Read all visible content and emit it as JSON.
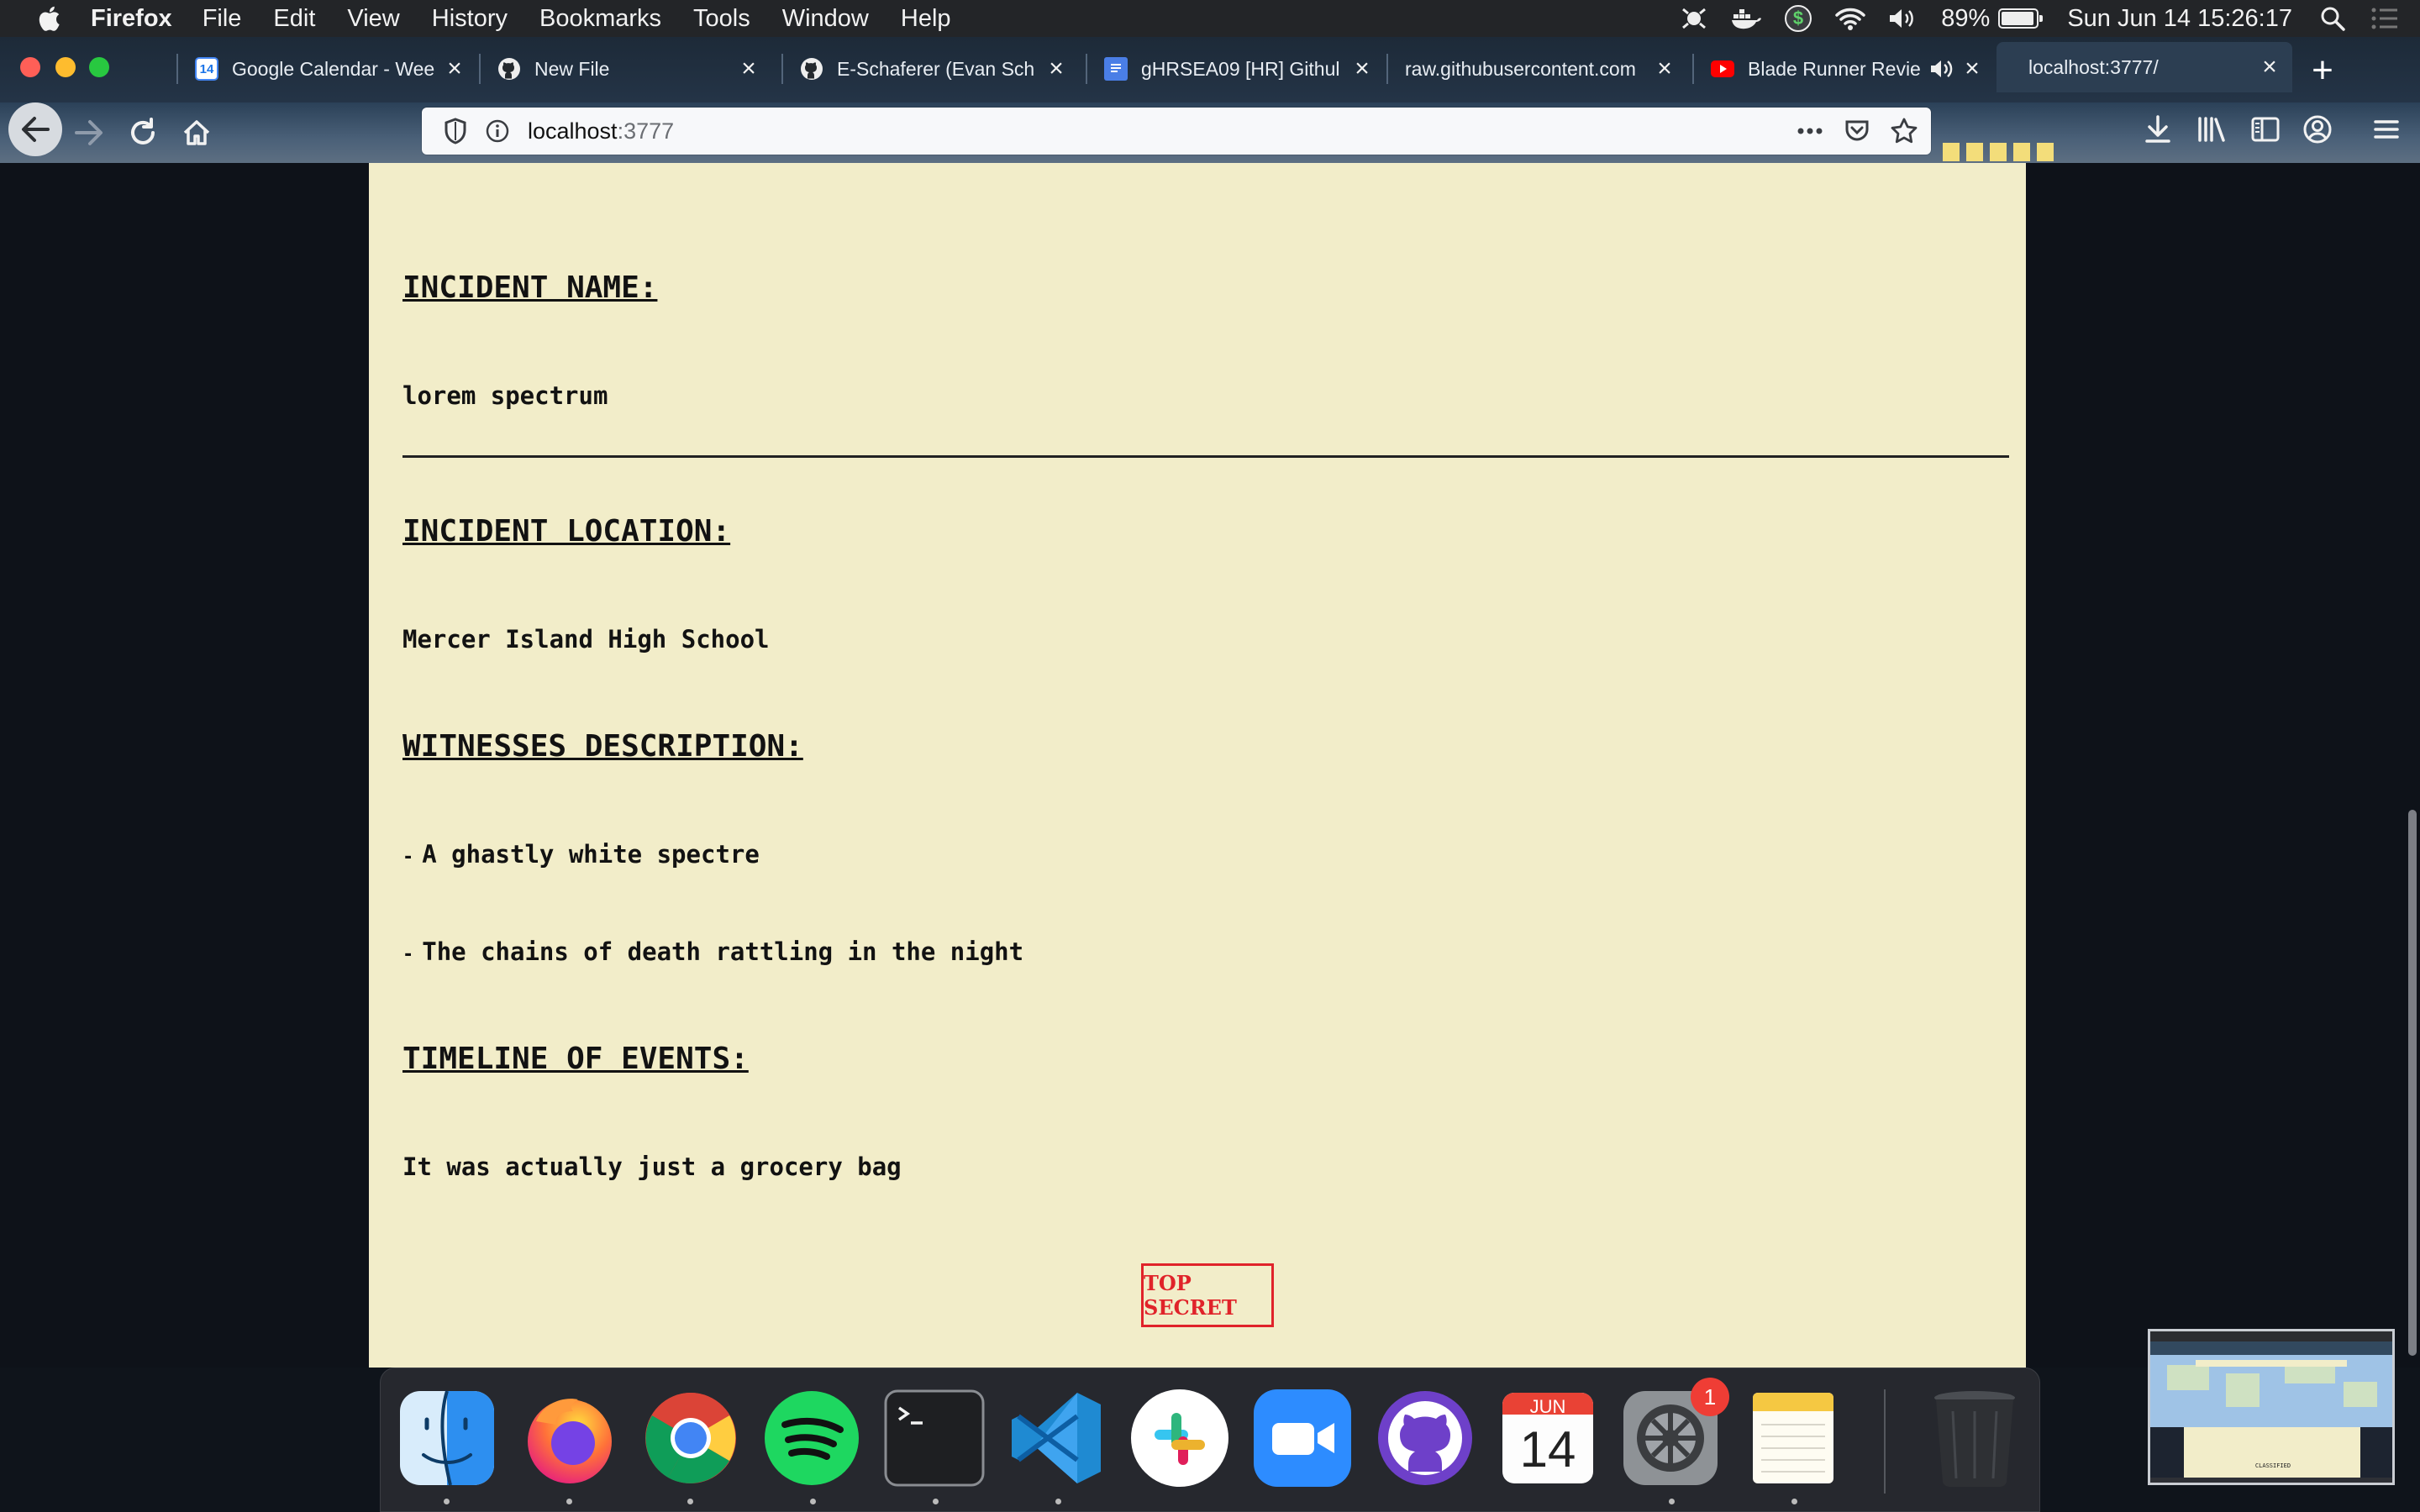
{
  "menubar": {
    "app_name": "Firefox",
    "items": [
      "File",
      "Edit",
      "View",
      "History",
      "Bookmarks",
      "Tools",
      "Window",
      "Help"
    ],
    "battery": "89%",
    "clock": "Sun Jun 14  15:26:17"
  },
  "tabs": [
    {
      "title": "Google Calendar - Wee",
      "icon": "google-calendar-icon",
      "favicon_text": "14"
    },
    {
      "title": "New File",
      "icon": "github-icon"
    },
    {
      "title": "E-Schaferer (Evan Sch",
      "icon": "github-icon"
    },
    {
      "title": "gHRSEA09 [HR] Githul",
      "icon": "google-docs-icon"
    },
    {
      "title": "raw.githubusercontent.com",
      "icon": ""
    },
    {
      "title": "Blade Runner Revie",
      "icon": "youtube-icon"
    },
    {
      "title": "localhost:3777/",
      "icon": ""
    }
  ],
  "urlbar": {
    "host": "localhost",
    "port": ":3777"
  },
  "page": {
    "incident_name_heading": "INCIDENT NAME:",
    "incident_name": "lorem spectrum",
    "incident_location_heading": "INCIDENT LOCATION:",
    "incident_location": "Mercer Island High School",
    "witnesses_heading": "WITNESSES DESCRIPTION:",
    "bullet_char": "-",
    "witnesses": [
      "A ghastly white spectre",
      "The chains of death rattling in the night"
    ],
    "timeline_heading": "TIMELINE OF EVENTS:",
    "timeline": "It was actually just a grocery bag",
    "stamp": "TOP SECRET"
  },
  "dock": {
    "apps": [
      "Finder",
      "Firefox",
      "Google Chrome",
      "Spotify",
      "Terminal",
      "Visual Studio Code",
      "Slack",
      "Zoom",
      "GitHub Desktop",
      "Calendar",
      "System Preferences",
      "Notes",
      "Trash"
    ],
    "calendar_month": "JUN",
    "calendar_day": "14",
    "system_prefs_badge": "1"
  },
  "thumbnail": {
    "label": "CLASSIFIED"
  },
  "colors": {
    "paper": "#f2edc9",
    "stamp": "#e0232a",
    "page_bg": "#0e1219"
  }
}
